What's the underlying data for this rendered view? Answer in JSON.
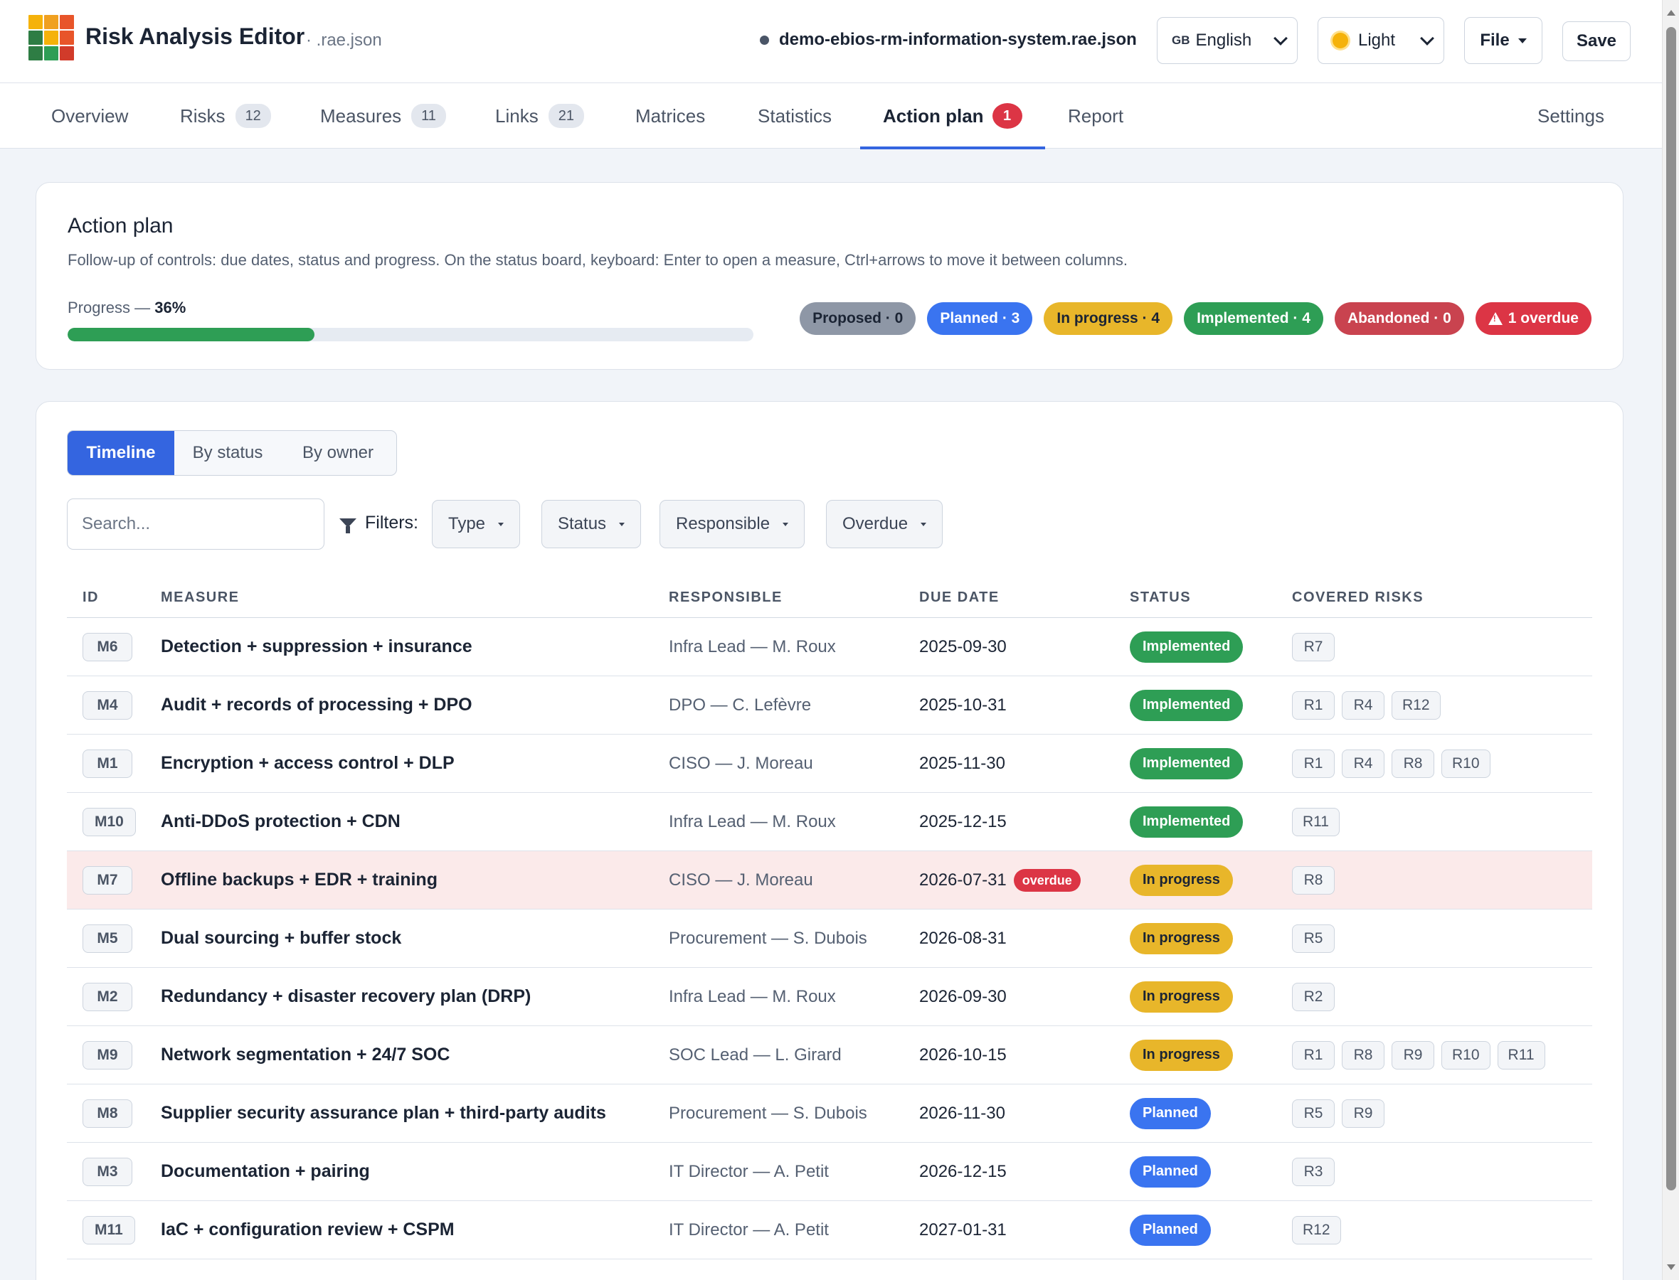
{
  "app": {
    "title": "Risk Analysis Editor",
    "extension": "· .rae.json",
    "logo_colors": [
      "#f5b20a",
      "#f0a020",
      "#e8552a",
      "#2e7d44",
      "#f5b20a",
      "#e8552a",
      "#2e7d44",
      "#2e9e55",
      "#d13b2a"
    ]
  },
  "header": {
    "filename": "demo-ebios-rm-information-system.rae.json",
    "language": {
      "flag": "GB",
      "label": "English"
    },
    "theme": {
      "icon": "sun-icon",
      "label": "Light"
    },
    "file_label": "File",
    "save_label": "Save"
  },
  "tabs": [
    {
      "label": "Overview"
    },
    {
      "label": "Risks",
      "count": "12"
    },
    {
      "label": "Measures",
      "count": "11"
    },
    {
      "label": "Links",
      "count": "21"
    },
    {
      "label": "Matrices"
    },
    {
      "label": "Statistics"
    },
    {
      "label": "Action plan",
      "alert": "1",
      "active": true
    },
    {
      "label": "Report"
    },
    {
      "label": "Settings"
    }
  ],
  "action_plan": {
    "title": "Action plan",
    "description": "Follow-up of controls: due dates, status and progress. On the status board, keyboard: Enter to open a measure, Ctrl+arrows to move it between columns.",
    "progress_label": "Progress — ",
    "progress_value": "36%",
    "progress_fraction": 0.36,
    "pills": {
      "proposed": "Proposed · 0",
      "planned": "Planned · 3",
      "inprog": "In progress · 4",
      "impl": "Implemented · 4",
      "aband": "Abandoned · 0",
      "overdue": "1 overdue"
    },
    "colors": {
      "proposed": "#8e97a6",
      "planned": "#3a74f0",
      "in_progress": "#e8b62a",
      "implemented": "#2e9e55",
      "abandoned": "#c9434f",
      "overdue": "#dc3545"
    }
  },
  "views": {
    "timeline": "Timeline",
    "by_status": "By status",
    "by_owner": "By owner",
    "active": "Timeline"
  },
  "filters": {
    "search_placeholder": "Search...",
    "label": "Filters:",
    "type": "Type",
    "status": "Status",
    "responsible": "Responsible",
    "overdue": "Overdue"
  },
  "table": {
    "headers": {
      "id": "ID",
      "measure": "Measure",
      "responsible": "Responsible",
      "due": "Due date",
      "status": "Status",
      "risks": "Covered risks"
    },
    "rows": [
      {
        "id": "M6",
        "measure": "Detection + suppression + insurance",
        "responsible": "Infra Lead — M. Roux",
        "due": "2025-09-30",
        "status": "Implemented",
        "status_key": "impl",
        "risks": [
          "R7"
        ]
      },
      {
        "id": "M4",
        "measure": "Audit + records of processing + DPO",
        "responsible": "DPO — C. Lefèvre",
        "due": "2025-10-31",
        "status": "Implemented",
        "status_key": "impl",
        "risks": [
          "R1",
          "R4",
          "R12"
        ]
      },
      {
        "id": "M1",
        "measure": "Encryption + access control + DLP",
        "responsible": "CISO — J. Moreau",
        "due": "2025-11-30",
        "status": "Implemented",
        "status_key": "impl",
        "risks": [
          "R1",
          "R4",
          "R8",
          "R10"
        ]
      },
      {
        "id": "M10",
        "measure": "Anti-DDoS protection + CDN",
        "responsible": "Infra Lead — M. Roux",
        "due": "2025-12-15",
        "status": "Implemented",
        "status_key": "impl",
        "risks": [
          "R11"
        ]
      },
      {
        "id": "M7",
        "measure": "Offline backups + EDR + training",
        "responsible": "CISO — J. Moreau",
        "due": "2026-07-31",
        "overdue": "overdue",
        "status": "In progress",
        "status_key": "inprog",
        "risks": [
          "R8"
        ]
      },
      {
        "id": "M5",
        "measure": "Dual sourcing + buffer stock",
        "responsible": "Procurement — S. Dubois",
        "due": "2026-08-31",
        "status": "In progress",
        "status_key": "inprog",
        "risks": [
          "R5"
        ]
      },
      {
        "id": "M2",
        "measure": "Redundancy + disaster recovery plan (DRP)",
        "responsible": "Infra Lead — M. Roux",
        "due": "2026-09-30",
        "status": "In progress",
        "status_key": "inprog",
        "risks": [
          "R2"
        ]
      },
      {
        "id": "M9",
        "measure": "Network segmentation + 24/7 SOC",
        "responsible": "SOC Lead — L. Girard",
        "due": "2026-10-15",
        "status": "In progress",
        "status_key": "inprog",
        "risks": [
          "R1",
          "R8",
          "R9",
          "R10",
          "R11"
        ]
      },
      {
        "id": "M8",
        "measure": "Supplier security assurance plan + third-party audits",
        "responsible": "Procurement — S. Dubois",
        "due": "2026-11-30",
        "status": "Planned",
        "status_key": "planned",
        "risks": [
          "R5",
          "R9"
        ]
      },
      {
        "id": "M3",
        "measure": "Documentation + pairing",
        "responsible": "IT Director — A. Petit",
        "due": "2026-12-15",
        "status": "Planned",
        "status_key": "planned",
        "risks": [
          "R3"
        ]
      },
      {
        "id": "M11",
        "measure": "IaC + configuration review + CSPM",
        "responsible": "IT Director — A. Petit",
        "due": "2027-01-31",
        "status": "Planned",
        "status_key": "planned",
        "risks": [
          "R12"
        ]
      }
    ]
  }
}
